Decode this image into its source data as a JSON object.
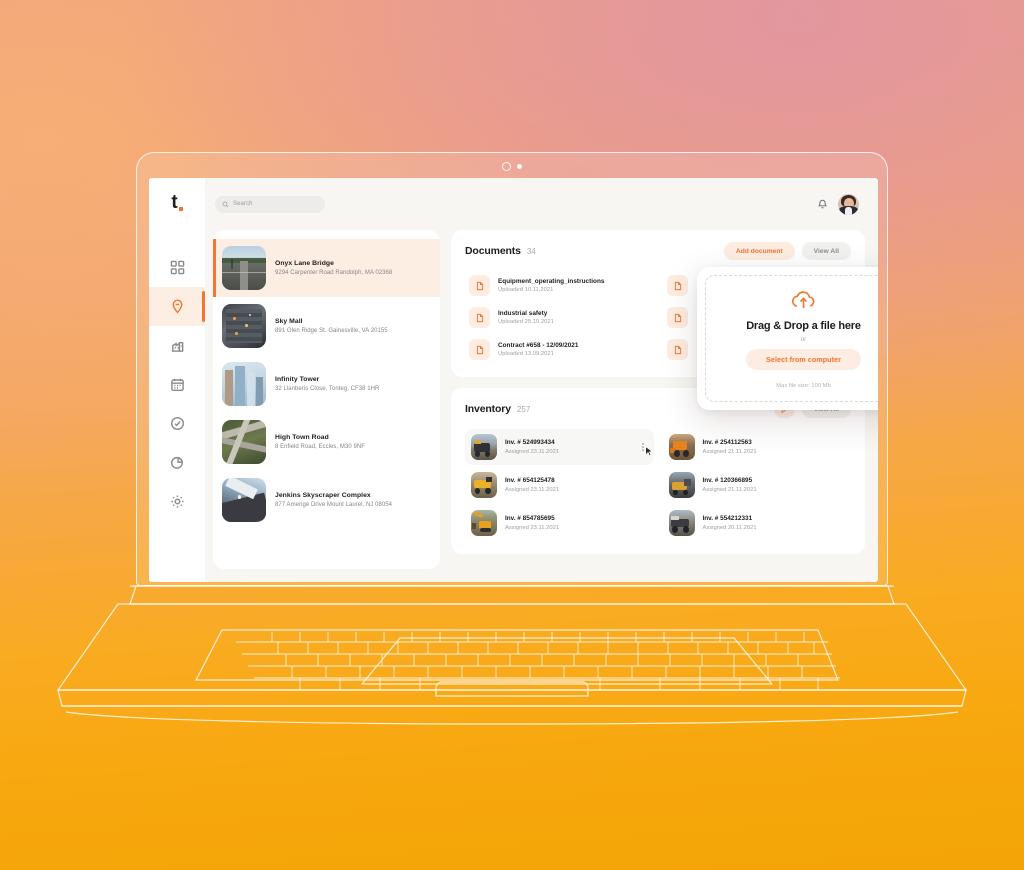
{
  "brand": {
    "logo_text": "t",
    "accent": "#f2762e"
  },
  "topbar": {
    "search_placeholder": "Search",
    "search_value": ""
  },
  "sidebar": {
    "items": [
      {
        "icon": "grid-icon",
        "name": "dashboard",
        "active": false
      },
      {
        "icon": "location-pin-icon",
        "name": "projects",
        "active": true
      },
      {
        "icon": "factory-icon",
        "name": "sites",
        "active": false
      },
      {
        "icon": "calendar-icon",
        "name": "calendar",
        "active": false
      },
      {
        "icon": "clock-check-icon",
        "name": "tasks",
        "active": false
      },
      {
        "icon": "pie-chart-icon",
        "name": "reports",
        "active": false
      },
      {
        "icon": "gear-icon",
        "name": "settings",
        "active": false
      }
    ]
  },
  "properties": [
    {
      "title": "Onyx Lane Bridge",
      "address": "9294 Carpenter Road Randolph, MA 02368",
      "thumb": "t-bridge",
      "active": true
    },
    {
      "title": "Sky Mall",
      "address": "891 Glen Ridge St. Gainesville, VA 20155",
      "thumb": "t-mall",
      "active": false
    },
    {
      "title": "Infinity Tower",
      "address": "32 Llanberis Close, Tonteg, CF38 1HR",
      "thumb": "t-tower",
      "active": false
    },
    {
      "title": "High Town Road",
      "address": "8 Enfield Road, Eccles, M30 9NF",
      "thumb": "t-road",
      "active": false
    },
    {
      "title": "Jenkins Skyscraper Complex",
      "address": "877 Amerige Drive Mount Laurel, NJ 08054",
      "thumb": "t-jenkins",
      "active": false
    }
  ],
  "documents": {
    "title": "Documents",
    "count": "34",
    "add_label": "Add document",
    "view_all_label": "View All",
    "items": [
      {
        "name": "Equipment_operating_instructions",
        "sub": "Uploaded 10.11.2021"
      },
      {
        "name": "",
        "sub": ""
      },
      {
        "name": "Industrial safety",
        "sub": "Uploaded 25.10.2021"
      },
      {
        "name": "",
        "sub": ""
      },
      {
        "name": "Contract #658 - 12/09/2021",
        "sub": "Uploaded 13.09.2021"
      },
      {
        "name": "",
        "sub": ""
      }
    ]
  },
  "inventory": {
    "title": "Inventory",
    "count": "257",
    "edit_icon": "pencil-icon",
    "view_all_label": "View All",
    "items": [
      {
        "name": "Inv. # 524993434",
        "sub": "Assigned 23.11.2021",
        "thumb": "t-truck",
        "hover": true
      },
      {
        "name": "Inv. # 254112563",
        "sub": "Assigned 21.11.2021",
        "thumb": "t-loader",
        "hover": false
      },
      {
        "name": "Inv. # 654125478",
        "sub": "Assigned 23.11.2021",
        "thumb": "t-dumper",
        "hover": false
      },
      {
        "name": "Inv. # 120366895",
        "sub": "Assigned 21.11.2021",
        "thumb": "t-night",
        "hover": false
      },
      {
        "name": "Inv. # 854785695",
        "sub": "Assigned 23.11.2021",
        "thumb": "t-excav",
        "hover": false
      },
      {
        "name": "Inv. # 554212331",
        "sub": "Assigned 20.11.2021",
        "thumb": "t-haul",
        "hover": false
      }
    ]
  },
  "upload_modal": {
    "icon": "cloud-upload-icon",
    "title": "Drag & Drop a file here",
    "or": "or",
    "button_label": "Select from computer",
    "max_size": "Max file size: 100 Mb"
  }
}
